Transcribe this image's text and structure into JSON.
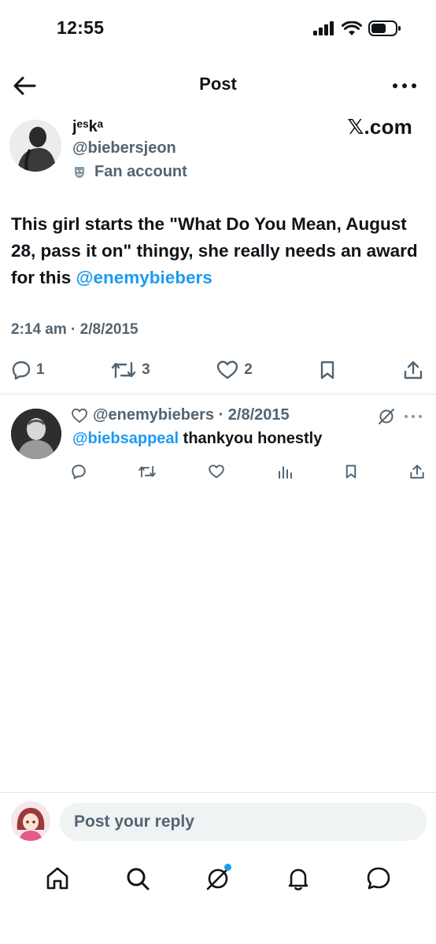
{
  "status_bar": {
    "time": "12:55"
  },
  "header": {
    "title": "Post"
  },
  "post": {
    "display_name": "jᵉˢkᵃ",
    "handle": "@biebersjeon",
    "fan_label": "Fan account",
    "brand": "𝕏.com",
    "text_before": "This girl starts the \"What Do You Mean, August 28, pass it on\" thingy, she really needs an award for this ",
    "mention": "@enemybiebers",
    "timestamp": "2:14 am · 2/8/2015",
    "replies": "1",
    "reposts": "3",
    "likes": "2"
  },
  "reply": {
    "author": "@enemybiebers · 2/8/2015",
    "mention": "@biebsappeal",
    "text": " thankyou honestly"
  },
  "composer": {
    "placeholder": "Post your reply"
  },
  "colors": {
    "accent": "#1d9bf0",
    "secondary_text": "#536471",
    "divider": "#e1e6ea"
  }
}
